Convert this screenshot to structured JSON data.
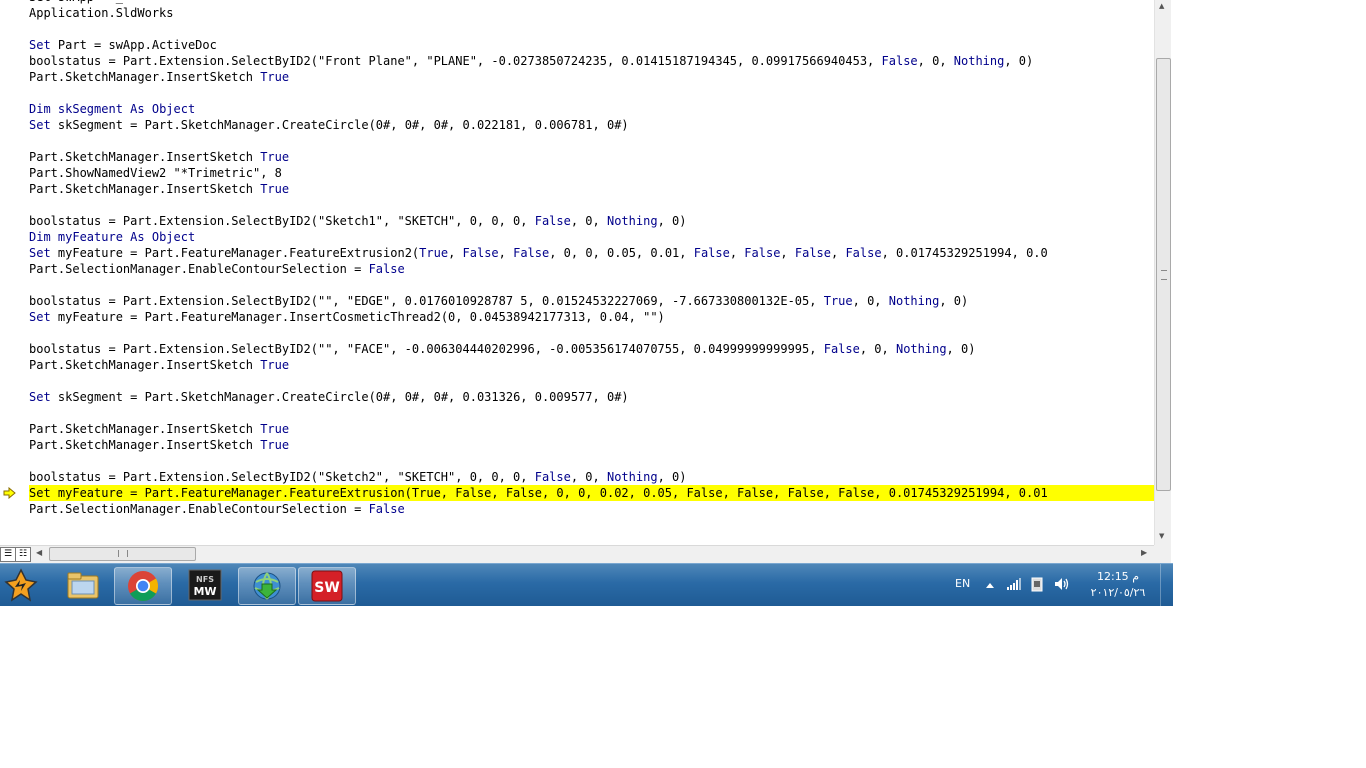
{
  "editor": {
    "lines": [
      [
        {
          "t": "Set swApp = _"
        }
      ],
      [
        {
          "t": "Application.SldWorks"
        }
      ],
      [
        {
          "t": ""
        }
      ],
      [
        {
          "t": "Set",
          "k": 1
        },
        {
          "t": " Part = swApp.ActiveDoc"
        }
      ],
      [
        {
          "t": "boolstatus = Part.Extension.SelectByID2(\"Front Plane\", \"PLANE\", -0.0273850724235, 0.01415187194345, 0.09917566940453, "
        },
        {
          "t": "False",
          "k": 1
        },
        {
          "t": ", 0, "
        },
        {
          "t": "Nothing",
          "k": 1
        },
        {
          "t": ", 0)"
        }
      ],
      [
        {
          "t": "Part.SketchManager.InsertSketch "
        },
        {
          "t": "True",
          "k": 1
        }
      ],
      [
        {
          "t": ""
        }
      ],
      [
        {
          "t": "Dim",
          "k": 1
        },
        {
          "t": " skSegment ",
          "k": 1
        },
        {
          "t": "As Object",
          "k": 1
        }
      ],
      [
        {
          "t": "Set",
          "k": 1
        },
        {
          "t": " skSegment = Part.SketchManager.CreateCircle(0#, 0#, 0#, 0.022181, 0.006781, 0#)"
        }
      ],
      [
        {
          "t": ""
        }
      ],
      [
        {
          "t": "Part.SketchManager.InsertSketch "
        },
        {
          "t": "True",
          "k": 1
        }
      ],
      [
        {
          "t": "Part.ShowNamedView2 \"*Trimetric\", 8"
        }
      ],
      [
        {
          "t": "Part.SketchManager.InsertSketch "
        },
        {
          "t": "True",
          "k": 1
        }
      ],
      [
        {
          "t": ""
        }
      ],
      [
        {
          "t": "boolstatus = Part.Extension.SelectByID2(\"Sketch1\", \"SKETCH\", 0, 0, 0, "
        },
        {
          "t": "False",
          "k": 1
        },
        {
          "t": ", 0, "
        },
        {
          "t": "Nothing",
          "k": 1
        },
        {
          "t": ", 0)"
        }
      ],
      [
        {
          "t": "Dim",
          "k": 1
        },
        {
          "t": " myFeature ",
          "k": 1
        },
        {
          "t": "As Object",
          "k": 1
        }
      ],
      [
        {
          "t": "Set",
          "k": 1
        },
        {
          "t": " myFeature = Part.FeatureManager.FeatureExtrusion2("
        },
        {
          "t": "True",
          "k": 1
        },
        {
          "t": ", "
        },
        {
          "t": "False",
          "k": 1
        },
        {
          "t": ", "
        },
        {
          "t": "False",
          "k": 1
        },
        {
          "t": ", 0, 0, 0.05, 0.01, "
        },
        {
          "t": "False",
          "k": 1
        },
        {
          "t": ", "
        },
        {
          "t": "False",
          "k": 1
        },
        {
          "t": ", "
        },
        {
          "t": "False",
          "k": 1
        },
        {
          "t": ", "
        },
        {
          "t": "False",
          "k": 1
        },
        {
          "t": ", 0.01745329251994, 0.0"
        }
      ],
      [
        {
          "t": "Part.SelectionManager.EnableContourSelection = "
        },
        {
          "t": "False",
          "k": 1
        }
      ],
      [
        {
          "t": ""
        }
      ],
      [
        {
          "t": "boolstatus = Part.Extension.SelectByID2(\"\", \"EDGE\", 0.0176010928787 5, 0.01524532227069, -7.667330800132E-05, "
        },
        {
          "t": "True",
          "k": 1
        },
        {
          "t": ", 0, "
        },
        {
          "t": "Nothing",
          "k": 1
        },
        {
          "t": ", 0)"
        }
      ],
      [
        {
          "t": "Set",
          "k": 1
        },
        {
          "t": " myFeature = Part.FeatureManager.InsertCosmeticThread2(0, 0.04538942177313, 0.04, \"\")"
        }
      ],
      [
        {
          "t": ""
        }
      ],
      [
        {
          "t": "boolstatus = Part.Extension.SelectByID2(\"\", \"FACE\", -0.006304440202996, -0.005356174070755, 0.04999999999995, "
        },
        {
          "t": "False",
          "k": 1
        },
        {
          "t": ", 0, "
        },
        {
          "t": "Nothing",
          "k": 1
        },
        {
          "t": ", 0)"
        }
      ],
      [
        {
          "t": "Part.SketchManager.InsertSketch "
        },
        {
          "t": "True",
          "k": 1
        }
      ],
      [
        {
          "t": ""
        }
      ],
      [
        {
          "t": "Set",
          "k": 1
        },
        {
          "t": " skSegment = Part.SketchManager.CreateCircle(0#, 0#, 0#, 0.031326, 0.009577, 0#)"
        }
      ],
      [
        {
          "t": ""
        }
      ],
      [
        {
          "t": "Part.SketchManager.InsertSketch "
        },
        {
          "t": "True",
          "k": 1
        }
      ],
      [
        {
          "t": "Part.SketchManager.InsertSketch "
        },
        {
          "t": "True",
          "k": 1
        }
      ],
      [
        {
          "t": ""
        }
      ],
      [
        {
          "t": "boolstatus = Part.Extension.SelectByID2(\"Sketch2\", \"SKETCH\", 0, 0, 0, "
        },
        {
          "t": "False",
          "k": 1
        },
        {
          "t": ", 0, "
        },
        {
          "t": "Nothing",
          "k": 1
        },
        {
          "t": ", 0)"
        }
      ],
      [
        {
          "t": "Set myFeature = Part.FeatureManager.FeatureExtrusion(True, False, False, 0, 0, 0.02, 0.05, False, False, False, False, 0.01745329251994, 0.01"
        }
      ],
      [
        {
          "t": "Part.SelectionManager.EnableContourSelection = "
        },
        {
          "t": "False",
          "k": 1
        }
      ]
    ],
    "highlighted_line": 31,
    "keyword_color": "#00008b",
    "highlight_color": "#ffff00"
  },
  "scrollbars": {
    "vertical_grip": "≡",
    "horizontal_grip": "III"
  },
  "taskbar": {
    "apps": [
      {
        "name": "winamp-icon"
      },
      {
        "name": "file-explorer-icon"
      },
      {
        "name": "chrome-icon"
      },
      {
        "name": "need-for-speed-most-wanted-icon",
        "label": "MW"
      },
      {
        "name": "internet-download-manager-icon"
      },
      {
        "name": "solidworks-icon",
        "label": "SW"
      }
    ],
    "language": "EN",
    "time": "12:15 م",
    "date": "٢٠١٢/٠٥/٢٦"
  }
}
